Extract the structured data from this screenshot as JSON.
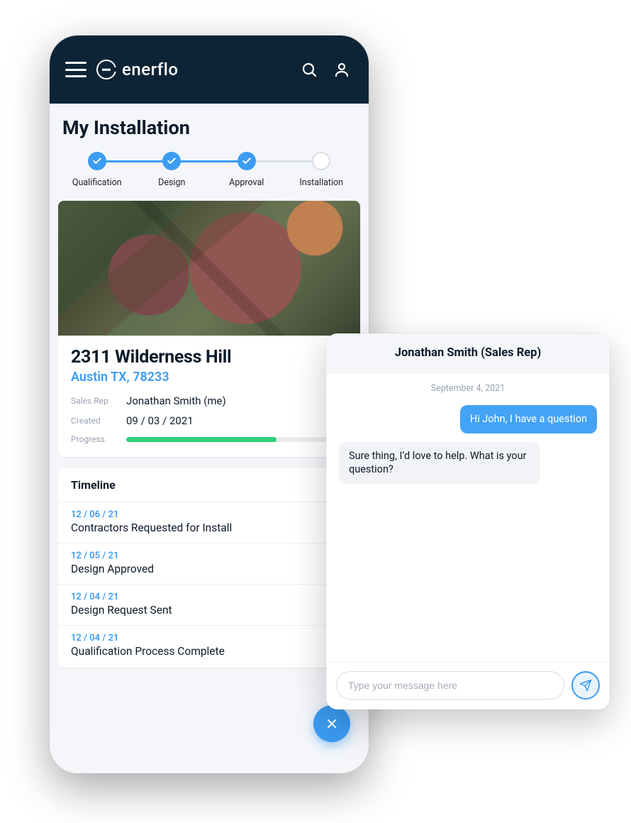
{
  "brand": {
    "name": "enerflo"
  },
  "page": {
    "title": "My Installation"
  },
  "stepper": {
    "steps": [
      {
        "label": "Qualification",
        "done": true
      },
      {
        "label": "Design",
        "done": true
      },
      {
        "label": "Approval",
        "done": true
      },
      {
        "label": "Installation",
        "done": false
      }
    ]
  },
  "property": {
    "address": "2311 Wilderness Hill",
    "city_state_zip": "Austin TX, 78233",
    "meta": {
      "sales_rep_label": "Sales Rep",
      "sales_rep": "Jonathan Smith (me)",
      "created_label": "Created",
      "created": "09 / 03 / 2021",
      "progress_label": "Progress",
      "progress_percent": 68
    }
  },
  "timeline": {
    "title": "Timeline",
    "items": [
      {
        "date": "12 / 06 / 21",
        "text": "Contractors Requested for Install"
      },
      {
        "date": "12 / 05 / 21",
        "text": "Design Approved"
      },
      {
        "date": "12 / 04 / 21",
        "text": "Design Request Sent"
      },
      {
        "date": "12 / 04 / 21",
        "text": "Qualification Process Complete"
      }
    ]
  },
  "chat": {
    "contact": "Jonathan Smith (Sales Rep)",
    "date": "September 4, 2021",
    "messages": [
      {
        "dir": "out",
        "text": "Hi John, I have a question"
      },
      {
        "dir": "in",
        "text": "Sure thing, I’d love to help. What is your question?"
      }
    ],
    "input_placeholder": "Type your message here"
  },
  "colors": {
    "accent": "#3b9cf2",
    "success": "#2dd07a",
    "darknav": "#0d2436"
  }
}
